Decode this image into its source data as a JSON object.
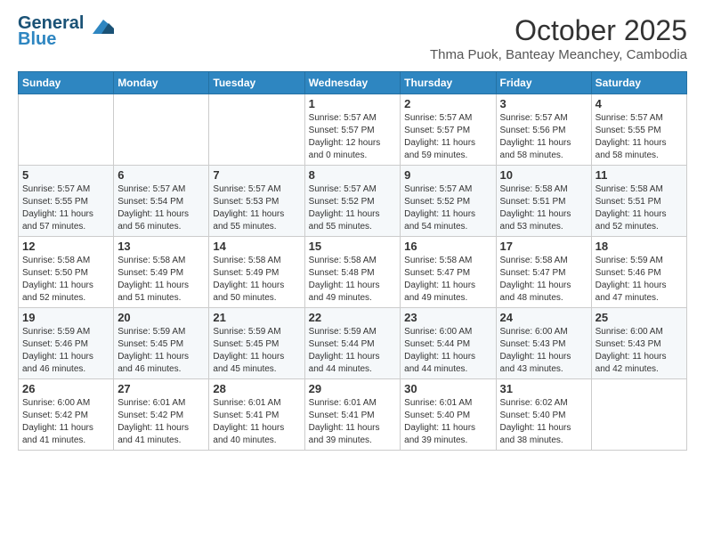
{
  "header": {
    "logo_line1": "General",
    "logo_line2": "Blue",
    "month": "October 2025",
    "location": "Thma Puok, Banteay Meanchey, Cambodia"
  },
  "days_of_week": [
    "Sunday",
    "Monday",
    "Tuesday",
    "Wednesday",
    "Thursday",
    "Friday",
    "Saturday"
  ],
  "weeks": [
    [
      {
        "day": "",
        "info": ""
      },
      {
        "day": "",
        "info": ""
      },
      {
        "day": "",
        "info": ""
      },
      {
        "day": "1",
        "info": "Sunrise: 5:57 AM\nSunset: 5:57 PM\nDaylight: 12 hours\nand 0 minutes."
      },
      {
        "day": "2",
        "info": "Sunrise: 5:57 AM\nSunset: 5:57 PM\nDaylight: 11 hours\nand 59 minutes."
      },
      {
        "day": "3",
        "info": "Sunrise: 5:57 AM\nSunset: 5:56 PM\nDaylight: 11 hours\nand 58 minutes."
      },
      {
        "day": "4",
        "info": "Sunrise: 5:57 AM\nSunset: 5:55 PM\nDaylight: 11 hours\nand 58 minutes."
      }
    ],
    [
      {
        "day": "5",
        "info": "Sunrise: 5:57 AM\nSunset: 5:55 PM\nDaylight: 11 hours\nand 57 minutes."
      },
      {
        "day": "6",
        "info": "Sunrise: 5:57 AM\nSunset: 5:54 PM\nDaylight: 11 hours\nand 56 minutes."
      },
      {
        "day": "7",
        "info": "Sunrise: 5:57 AM\nSunset: 5:53 PM\nDaylight: 11 hours\nand 55 minutes."
      },
      {
        "day": "8",
        "info": "Sunrise: 5:57 AM\nSunset: 5:52 PM\nDaylight: 11 hours\nand 55 minutes."
      },
      {
        "day": "9",
        "info": "Sunrise: 5:57 AM\nSunset: 5:52 PM\nDaylight: 11 hours\nand 54 minutes."
      },
      {
        "day": "10",
        "info": "Sunrise: 5:58 AM\nSunset: 5:51 PM\nDaylight: 11 hours\nand 53 minutes."
      },
      {
        "day": "11",
        "info": "Sunrise: 5:58 AM\nSunset: 5:51 PM\nDaylight: 11 hours\nand 52 minutes."
      }
    ],
    [
      {
        "day": "12",
        "info": "Sunrise: 5:58 AM\nSunset: 5:50 PM\nDaylight: 11 hours\nand 52 minutes."
      },
      {
        "day": "13",
        "info": "Sunrise: 5:58 AM\nSunset: 5:49 PM\nDaylight: 11 hours\nand 51 minutes."
      },
      {
        "day": "14",
        "info": "Sunrise: 5:58 AM\nSunset: 5:49 PM\nDaylight: 11 hours\nand 50 minutes."
      },
      {
        "day": "15",
        "info": "Sunrise: 5:58 AM\nSunset: 5:48 PM\nDaylight: 11 hours\nand 49 minutes."
      },
      {
        "day": "16",
        "info": "Sunrise: 5:58 AM\nSunset: 5:47 PM\nDaylight: 11 hours\nand 49 minutes."
      },
      {
        "day": "17",
        "info": "Sunrise: 5:58 AM\nSunset: 5:47 PM\nDaylight: 11 hours\nand 48 minutes."
      },
      {
        "day": "18",
        "info": "Sunrise: 5:59 AM\nSunset: 5:46 PM\nDaylight: 11 hours\nand 47 minutes."
      }
    ],
    [
      {
        "day": "19",
        "info": "Sunrise: 5:59 AM\nSunset: 5:46 PM\nDaylight: 11 hours\nand 46 minutes."
      },
      {
        "day": "20",
        "info": "Sunrise: 5:59 AM\nSunset: 5:45 PM\nDaylight: 11 hours\nand 46 minutes."
      },
      {
        "day": "21",
        "info": "Sunrise: 5:59 AM\nSunset: 5:45 PM\nDaylight: 11 hours\nand 45 minutes."
      },
      {
        "day": "22",
        "info": "Sunrise: 5:59 AM\nSunset: 5:44 PM\nDaylight: 11 hours\nand 44 minutes."
      },
      {
        "day": "23",
        "info": "Sunrise: 6:00 AM\nSunset: 5:44 PM\nDaylight: 11 hours\nand 44 minutes."
      },
      {
        "day": "24",
        "info": "Sunrise: 6:00 AM\nSunset: 5:43 PM\nDaylight: 11 hours\nand 43 minutes."
      },
      {
        "day": "25",
        "info": "Sunrise: 6:00 AM\nSunset: 5:43 PM\nDaylight: 11 hours\nand 42 minutes."
      }
    ],
    [
      {
        "day": "26",
        "info": "Sunrise: 6:00 AM\nSunset: 5:42 PM\nDaylight: 11 hours\nand 41 minutes."
      },
      {
        "day": "27",
        "info": "Sunrise: 6:01 AM\nSunset: 5:42 PM\nDaylight: 11 hours\nand 41 minutes."
      },
      {
        "day": "28",
        "info": "Sunrise: 6:01 AM\nSunset: 5:41 PM\nDaylight: 11 hours\nand 40 minutes."
      },
      {
        "day": "29",
        "info": "Sunrise: 6:01 AM\nSunset: 5:41 PM\nDaylight: 11 hours\nand 39 minutes."
      },
      {
        "day": "30",
        "info": "Sunrise: 6:01 AM\nSunset: 5:40 PM\nDaylight: 11 hours\nand 39 minutes."
      },
      {
        "day": "31",
        "info": "Sunrise: 6:02 AM\nSunset: 5:40 PM\nDaylight: 11 hours\nand 38 minutes."
      },
      {
        "day": "",
        "info": ""
      }
    ]
  ]
}
